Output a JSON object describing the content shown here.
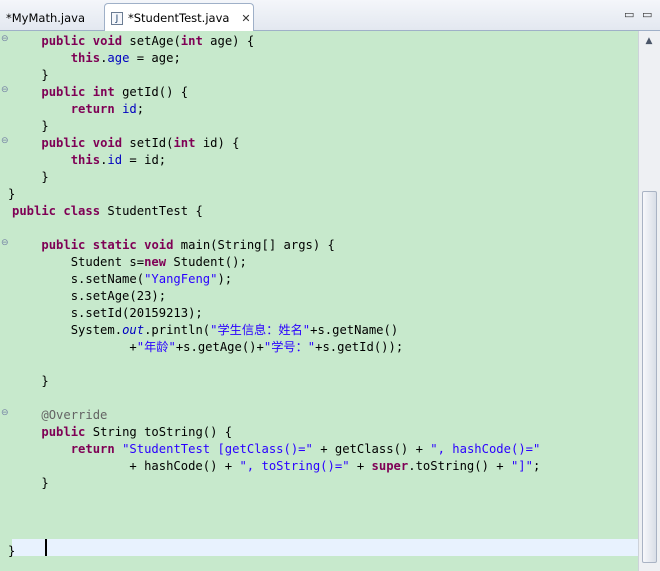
{
  "tabs": [
    {
      "label": "*MyMath.java",
      "active": false
    },
    {
      "label": "*StudentTest.java",
      "active": true,
      "icon": "J",
      "close": "✕"
    }
  ],
  "window_controls": {
    "minimize": "▭",
    "maximize": "▭"
  },
  "code": {
    "l1_a": "    ",
    "l1_kw1": "public",
    "l1_b": " ",
    "l1_kw2": "void",
    "l1_c": " setAge(",
    "l1_kw3": "int",
    "l1_d": " age) {",
    "l2_a": "        ",
    "l2_kw": "this",
    "l2_b": ".",
    "l2_fld": "age",
    "l2_c": " = age;",
    "l3": "    }",
    "l4_a": "    ",
    "l4_kw1": "public",
    "l4_b": " ",
    "l4_kw2": "int",
    "l4_c": " getId() {",
    "l5_a": "        ",
    "l5_kw": "return",
    "l5_b": " ",
    "l5_fld": "id",
    "l5_c": ";",
    "l6": "    }",
    "l7_a": "    ",
    "l7_kw1": "public",
    "l7_b": " ",
    "l7_kw2": "void",
    "l7_c": " setId(",
    "l7_kw3": "int",
    "l7_d": " id) {",
    "l8_a": "        ",
    "l8_kw": "this",
    "l8_b": ".",
    "l8_fld": "id",
    "l8_c": " = id;",
    "l9": "    }",
    "l10": "}",
    "l11_kw1": "public",
    "l11_b": " ",
    "l11_kw2": "class",
    "l11_c": " StudentTest {",
    "l13_a": "    ",
    "l13_kw1": "public",
    "l13_b": " ",
    "l13_kw2": "static",
    "l13_c": " ",
    "l13_kw3": "void",
    "l13_d": " main(String[] args) {",
    "l14_a": "        Student s=",
    "l14_kw": "new",
    "l14_b": " Student();",
    "l15_a": "        s.setName(",
    "l15_str": "\"YangFeng\"",
    "l15_b": ");",
    "l16": "        s.setAge(23);",
    "l17": "        s.setId(20159213);",
    "l18_a": "        System.",
    "l18_st": "out",
    "l18_b": ".println(",
    "l18_str": "\"学生信息：姓名\"",
    "l18_c": "+s.getName()",
    "l19_a": "                +",
    "l19_str1": "\"年龄\"",
    "l19_b": "+s.getAge()+",
    "l19_str2": "\"学号：\"",
    "l19_c": "+s.getId());",
    "l21": "    }",
    "l23_a": "    ",
    "l23_ann": "@Override",
    "l24_a": "    ",
    "l24_kw": "public",
    "l24_b": " String toString() {",
    "l25_a": "        ",
    "l25_kw": "return",
    "l25_b": " ",
    "l25_str1": "\"StudentTest [getClass()=\"",
    "l25_c": " + getClass() + ",
    "l25_str2": "\", hashCode()=\"",
    "l26_a": "                + hashCode() + ",
    "l26_str1": "\", toString()=\"",
    "l26_b": " + ",
    "l26_kw": "super",
    "l26_c": ".toString() + ",
    "l26_str2": "\"]\"",
    "l26_d": ";",
    "l27": "    }",
    "l31": "}"
  },
  "colors": {
    "editor_bg": "#c7e9cc",
    "keyword": "#7f0055",
    "field": "#0000c0",
    "string": "#2a00ff",
    "annotation": "#646464",
    "current_line": "#e8f2fe"
  },
  "icons": {
    "fold_marker": "⊖"
  }
}
